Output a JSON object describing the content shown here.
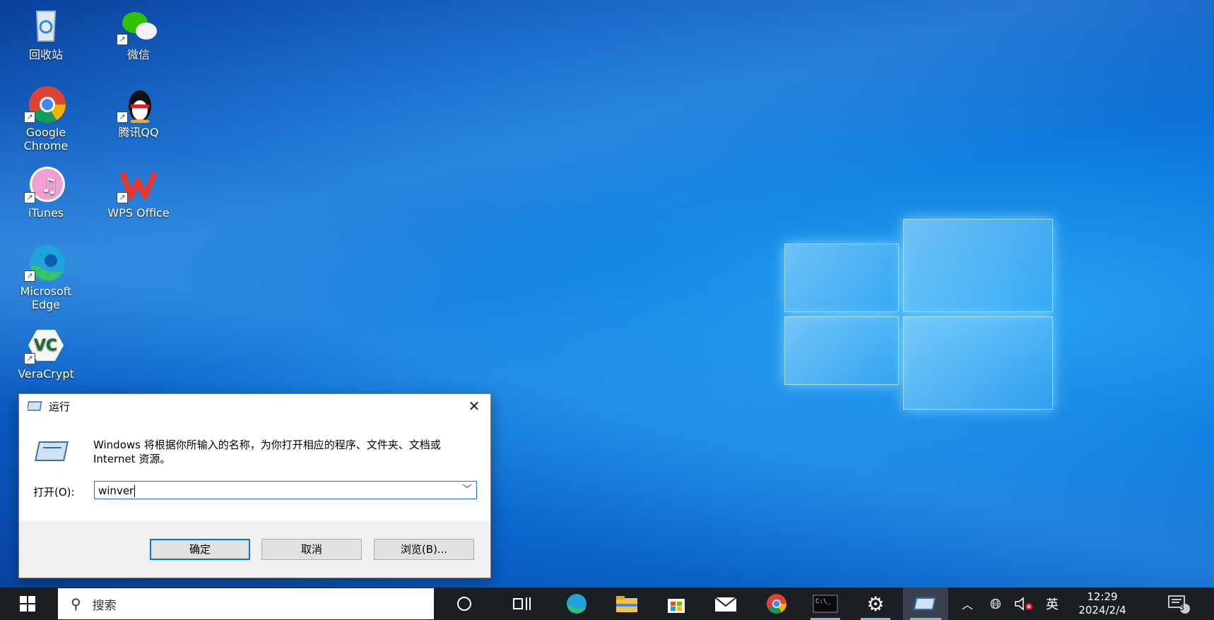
{
  "desktop": {
    "icons": [
      {
        "label": "回收站"
      },
      {
        "label": "微信"
      },
      {
        "label": "Google Chrome"
      },
      {
        "label": "腾讯QQ"
      },
      {
        "label": "iTunes"
      },
      {
        "label": "WPS Office"
      },
      {
        "label": "Microsoft Edge"
      },
      {
        "label": "VeraCrypt"
      }
    ]
  },
  "run_dialog": {
    "title": "运行",
    "description": "Windows 将根据你所输入的名称，为你打开相应的程序、文件夹、文档或 Internet 资源。",
    "open_label": "打开(O):",
    "input_value": "winver",
    "ok_label": "确定",
    "cancel_label": "取消",
    "browse_label": "浏览(B)..."
  },
  "taskbar": {
    "search_placeholder": "搜索",
    "apps": [
      "cortana-icon",
      "task-view-icon",
      "edge-icon",
      "file-explorer-icon",
      "store-icon",
      "mail-icon",
      "chrome-icon",
      "terminal-icon",
      "settings-icon",
      "run-icon"
    ],
    "ime": "英",
    "time": "12:29",
    "date": "2024/2/4",
    "notification_count": "3"
  }
}
